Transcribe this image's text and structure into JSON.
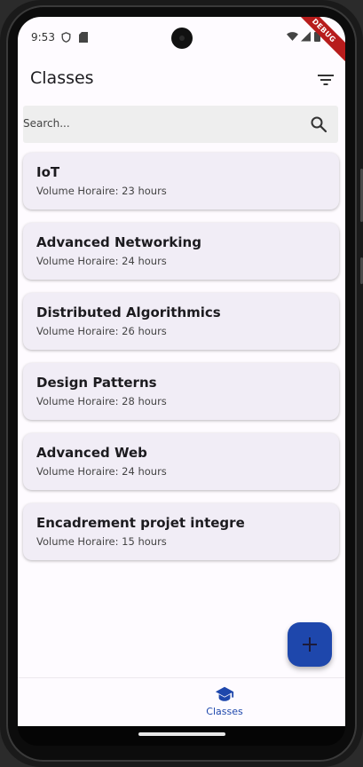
{
  "status_bar": {
    "time": "9:53",
    "debug_label": "DEBUG"
  },
  "app_bar": {
    "title": "Classes"
  },
  "search": {
    "placeholder": "Search..."
  },
  "classes": [
    {
      "name": "IoT",
      "hours": "Volume Horaire: 23 hours"
    },
    {
      "name": "Advanced Networking",
      "hours": "Volume Horaire: 24 hours"
    },
    {
      "name": "Distributed Algorithmics",
      "hours": "Volume Horaire: 26 hours"
    },
    {
      "name": "Design Patterns",
      "hours": "Volume Horaire: 28 hours"
    },
    {
      "name": "Advanced Web",
      "hours": "Volume Horaire: 24 hours"
    },
    {
      "name": "Encadrement projet integre",
      "hours": "Volume Horaire: 15 hours"
    }
  ],
  "fab": {
    "icon": "add-icon"
  },
  "bottom_nav": {
    "items": [
      {
        "label": "Classes",
        "icon": "school-icon"
      }
    ]
  },
  "colors": {
    "primary": "#1e47ac",
    "card": "#f1edf6",
    "background": "#fefbff",
    "debug": "#b71c1c"
  }
}
